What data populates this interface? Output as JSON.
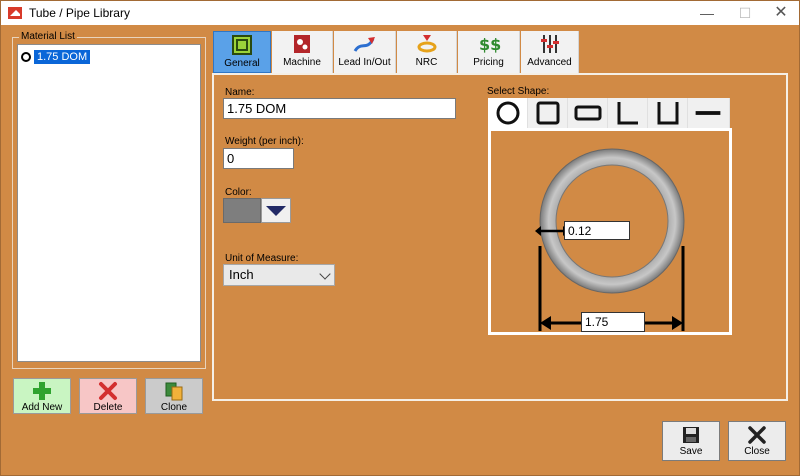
{
  "window": {
    "title": "Tube / Pipe Library",
    "controls": {
      "minimize": "—",
      "maximize": "☐",
      "close": "✕"
    }
  },
  "material_list": {
    "label": "Material List",
    "items": [
      {
        "label": "1.75 DOM",
        "selected": true
      }
    ],
    "buttons": {
      "add": "Add New",
      "delete": "Delete",
      "clone": "Clone"
    }
  },
  "tabs": [
    {
      "label": "General",
      "icon": "general-icon",
      "active": true
    },
    {
      "label": "Machine",
      "icon": "machine-icon"
    },
    {
      "label": "Lead In/Out",
      "icon": "lead-in-out-icon"
    },
    {
      "label": "NRC",
      "icon": "nrc-icon"
    },
    {
      "label": "Pricing",
      "icon": "pricing-icon"
    },
    {
      "label": "Advanced",
      "icon": "advanced-icon"
    }
  ],
  "general": {
    "name_label": "Name:",
    "name_value": "1.75 DOM",
    "weight_label": "Weight (per inch):",
    "weight_value": "0",
    "color_label": "Color:",
    "color_value": "#7e7e7e",
    "unit_label": "Unit of Measure:",
    "unit_value": "Inch",
    "shape_label": "Select Shape:",
    "shapes": [
      "round",
      "square",
      "rectangle",
      "angle",
      "channel",
      "flat"
    ],
    "selected_shape": "round",
    "wall_thickness": "0.12",
    "outer_diameter": "1.75"
  },
  "footer": {
    "save": "Save",
    "close": "Close"
  },
  "colors": {
    "background": "#d18a45",
    "tab_active": "#5aa1e8"
  }
}
